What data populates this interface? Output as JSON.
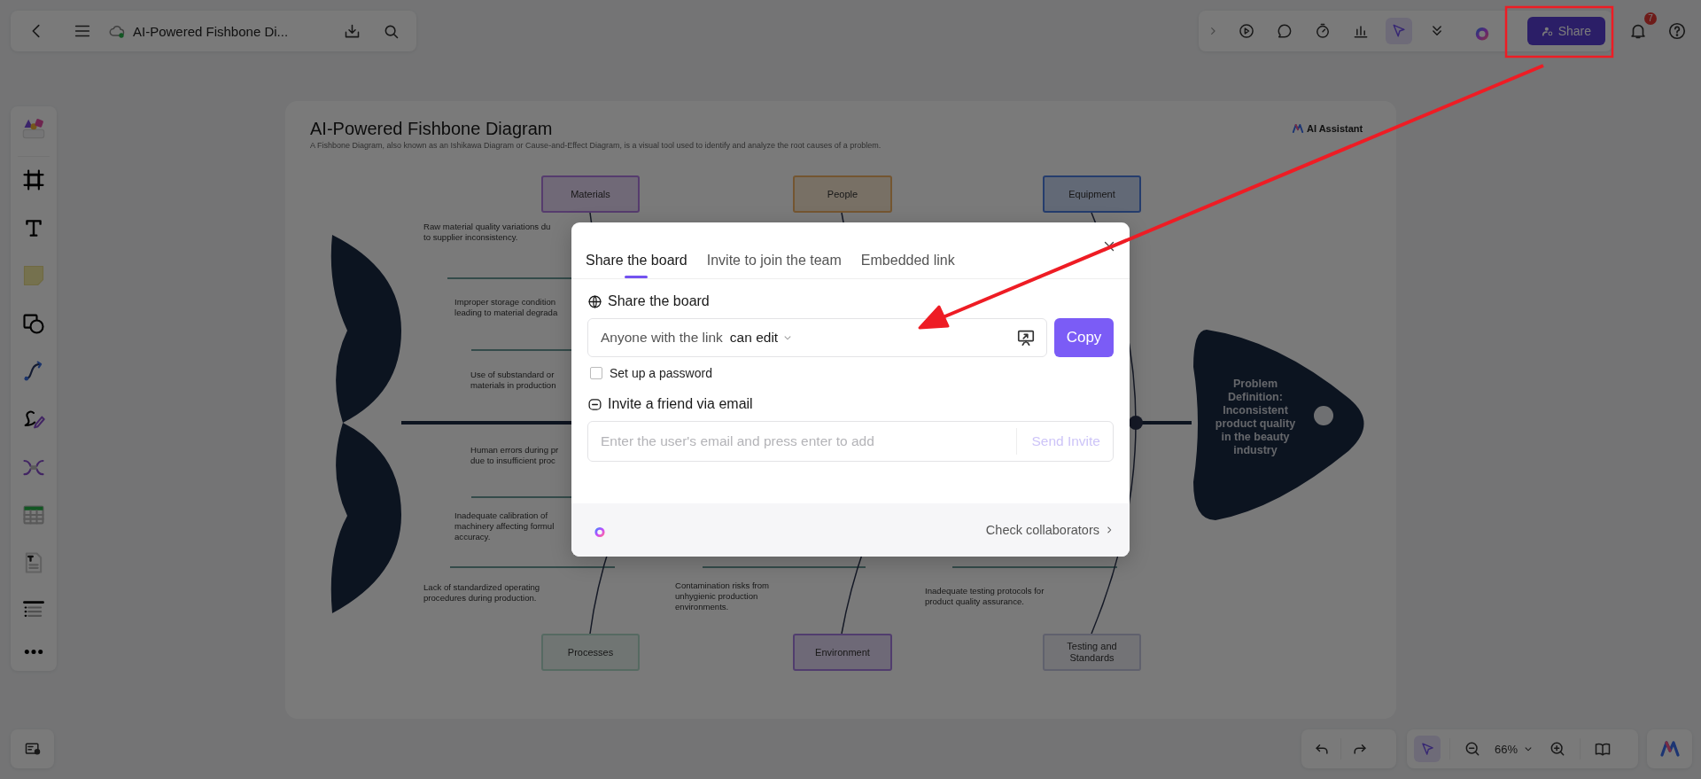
{
  "top_bar": {
    "document_title": "AI-Powered Fishbone Di...",
    "tools": [
      {
        "selected": false
      },
      {
        "selected": false
      },
      {
        "selected": false
      },
      {
        "selected": false
      },
      {
        "selected": true
      },
      {
        "selected": false
      }
    ],
    "share_button": "Share",
    "notification_count": "7"
  },
  "board": {
    "title": "AI-Powered Fishbone Diagram",
    "subtitle": "A Fishbone Diagram, also known as an Ishikawa Diagram or Cause-and-Effect Diagram, is a visual tool used to identify and analyze the root causes of a problem.",
    "ai_assistant": "AI Assistant",
    "categories": [
      {
        "label": "Materials",
        "color": "#563c6e"
      },
      {
        "label": "People",
        "color": "#745631"
      },
      {
        "label": "Equipment",
        "color": "#263d6d"
      },
      {
        "label": "Processes",
        "color": "#566a63"
      },
      {
        "label": "Environment",
        "color": "#513e6e"
      },
      {
        "label": "Testing and\nStandards",
        "color": "#60616d"
      }
    ],
    "causes": [
      {
        "text": "Raw material quality variations du\nto supplier inconsistency."
      },
      {
        "text": "Improper storage condition\nleading to material degrada"
      },
      {
        "text": "Use of substandard or\nmaterials in production"
      },
      {
        "text": "Human errors during pr\ndue to insufficient proc"
      },
      {
        "text": "Inadequate calibration of\nmachinery affecting formul\naccuracy."
      },
      {
        "text": "Lack of standardized operating\nprocedures during production."
      },
      {
        "text": "Contamination risks from\nunhygienic production\nenvironments."
      },
      {
        "text": "Inadequate testing protocols for\nproduct quality assurance."
      }
    ],
    "problem": "Problem\nDefinition:\nInconsistent\nproduct quality\nin the beauty\nindustry"
  },
  "dialog": {
    "tabs": [
      {
        "label": "Share the board",
        "selected": true
      },
      {
        "label": "Invite to join the team",
        "selected": false
      },
      {
        "label": "Embedded link",
        "selected": false
      }
    ],
    "share_heading": "Share the board",
    "link_access": "Anyone with the link",
    "permission": "can edit",
    "copy_button": "Copy",
    "password": {
      "label": "Set up a password",
      "checked": false
    },
    "invite_heading": "Invite a friend via email",
    "email": {
      "placeholder": "Enter the user's email and press enter to add"
    },
    "send_button": "Send Invite",
    "collaborators_link": "Check collaborators"
  },
  "bottom_bar": {
    "select_tool": {
      "selected": true
    },
    "zoom": "66%"
  }
}
